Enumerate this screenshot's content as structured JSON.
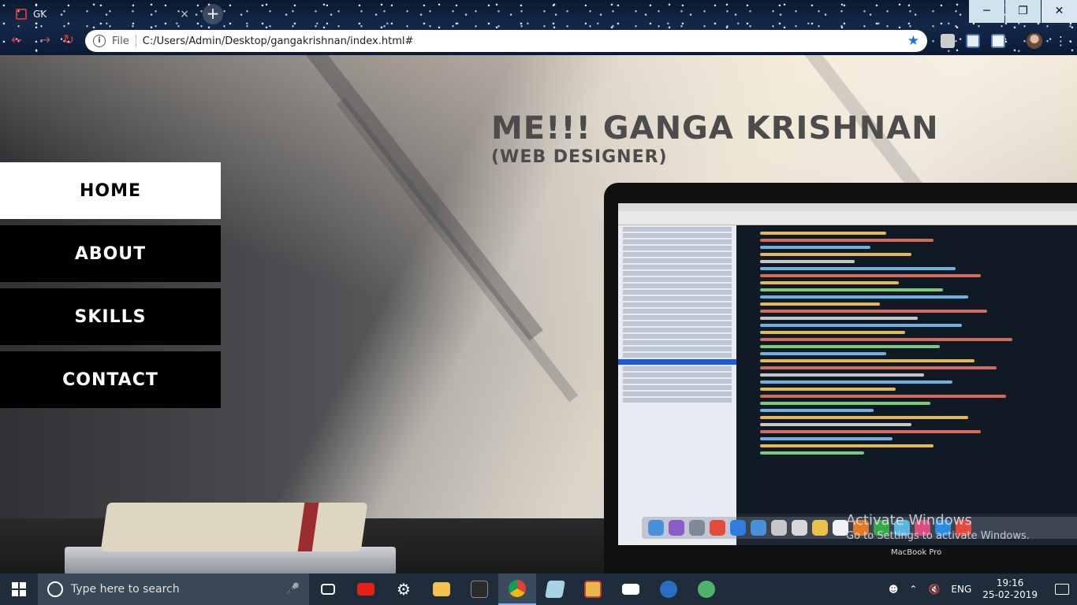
{
  "browser": {
    "tab_title": "GK",
    "tab_close": "×",
    "new_tab": "+",
    "url_scheme": "File",
    "url": "C:/Users/Admin/Desktop/gangakrishnan/index.html#",
    "window_minimize": "─",
    "window_restore": "❐",
    "window_close": "✕"
  },
  "page": {
    "heading_name": "ME!!! GANGA KRISHNAN",
    "heading_role": "(WEB DESIGNER)",
    "menu": [
      {
        "label": "HOME",
        "active": true
      },
      {
        "label": "ABOUT",
        "active": false
      },
      {
        "label": "SKILLS",
        "active": false
      },
      {
        "label": "CONTACT",
        "active": false
      }
    ],
    "laptop_brand": "MacBook Pro"
  },
  "watermark": {
    "line1": "Activate Windows",
    "line2": "Go to Settings to activate Windows."
  },
  "taskbar": {
    "search_placeholder": "Type here to search",
    "language": "ENG",
    "time": "19:16",
    "date": "25-02-2019"
  },
  "colors": {
    "menu_active_bg": "#ffffff",
    "menu_bg": "#000000",
    "heading": "#4c4c4c"
  }
}
